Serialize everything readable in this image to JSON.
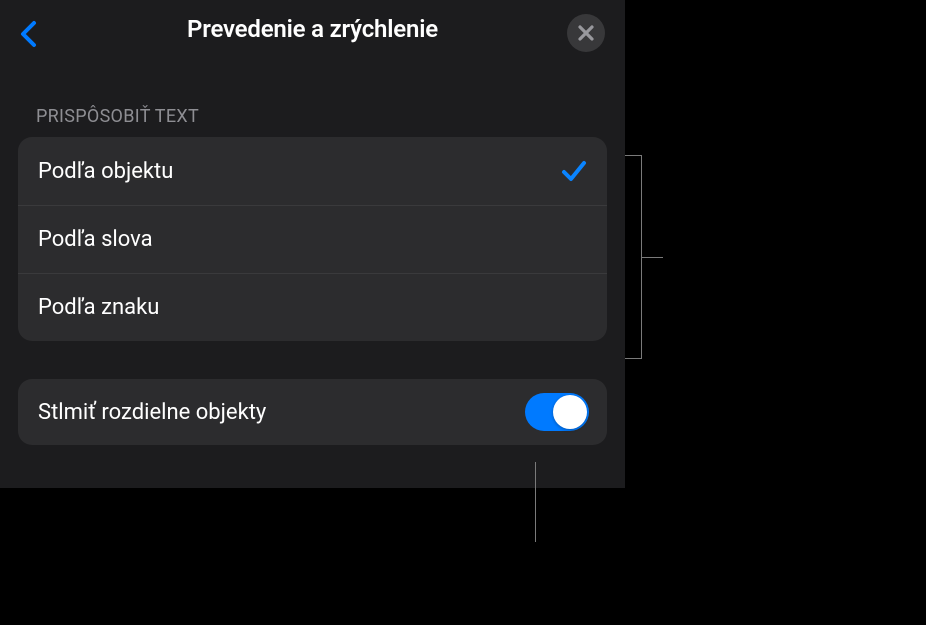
{
  "header": {
    "title": "Prevedenie a zrýchlenie"
  },
  "section": {
    "header": "PRISPÔSOBIŤ TEXT",
    "items": [
      {
        "label": "Podľa objektu",
        "selected": true
      },
      {
        "label": "Podľa slova",
        "selected": false
      },
      {
        "label": "Podľa znaku",
        "selected": false
      }
    ]
  },
  "toggle": {
    "label": "Stlmiť rozdielne objekty",
    "on": true
  }
}
